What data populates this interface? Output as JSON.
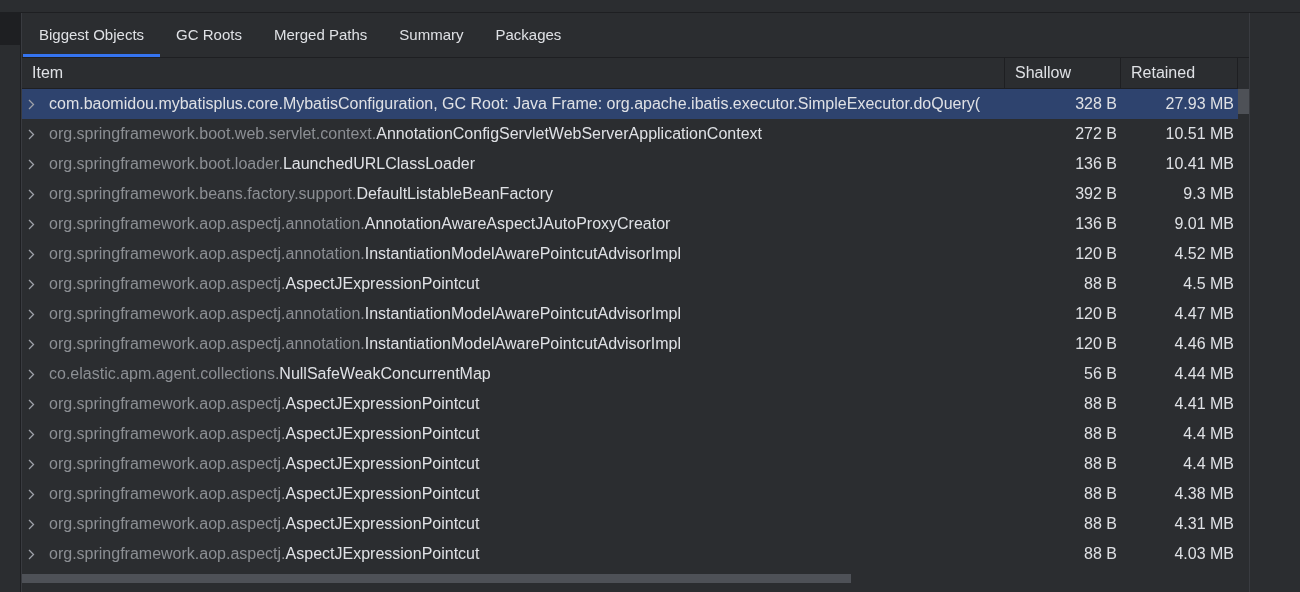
{
  "tabs": [
    {
      "label": "Biggest Objects",
      "selected": true
    },
    {
      "label": "GC Roots",
      "selected": false
    },
    {
      "label": "Merged Paths",
      "selected": false
    },
    {
      "label": "Summary",
      "selected": false
    },
    {
      "label": "Packages",
      "selected": false
    }
  ],
  "table": {
    "columns": [
      "Item",
      "Shallow",
      "Retained"
    ],
    "rows": [
      {
        "name": "com.baomidou.mybatisplus.core.MybatisConfiguration, GC Root: Java Frame: org.apache.ibatis.executor.SimpleExecutor.doQuery(",
        "shallow": "328 B",
        "retained": "27.93 MB",
        "selected": true
      },
      {
        "package": "org.springframework.boot.web.servlet.context.",
        "name": "AnnotationConfigServletWebServerApplicationContext",
        "shallow": "272 B",
        "retained": "10.51 MB",
        "selected": false
      },
      {
        "package": "org.springframework.boot.loader.",
        "name": "LaunchedURLClassLoader",
        "shallow": "136 B",
        "retained": "10.41 MB",
        "selected": false
      },
      {
        "package": "org.springframework.beans.factory.support.",
        "name": "DefaultListableBeanFactory",
        "shallow": "392 B",
        "retained": "9.3 MB",
        "selected": false
      },
      {
        "package": "org.springframework.aop.aspectj.annotation.",
        "name": "AnnotationAwareAspectJAutoProxyCreator",
        "shallow": "136 B",
        "retained": "9.01 MB",
        "selected": false
      },
      {
        "package": "org.springframework.aop.aspectj.annotation.",
        "name": "InstantiationModelAwarePointcutAdvisorImpl",
        "shallow": "120 B",
        "retained": "4.52 MB",
        "selected": false
      },
      {
        "package": "org.springframework.aop.aspectj.",
        "name": "AspectJExpressionPointcut",
        "shallow": "88 B",
        "retained": "4.5 MB",
        "selected": false
      },
      {
        "package": "org.springframework.aop.aspectj.annotation.",
        "name": "InstantiationModelAwarePointcutAdvisorImpl",
        "shallow": "120 B",
        "retained": "4.47 MB",
        "selected": false
      },
      {
        "package": "org.springframework.aop.aspectj.annotation.",
        "name": "InstantiationModelAwarePointcutAdvisorImpl",
        "shallow": "120 B",
        "retained": "4.46 MB",
        "selected": false
      },
      {
        "package": "co.elastic.apm.agent.collections.",
        "name": "NullSafeWeakConcurrentMap",
        "shallow": "56 B",
        "retained": "4.44 MB",
        "selected": false
      },
      {
        "package": "org.springframework.aop.aspectj.",
        "name": "AspectJExpressionPointcut",
        "shallow": "88 B",
        "retained": "4.41 MB",
        "selected": false
      },
      {
        "package": "org.springframework.aop.aspectj.",
        "name": "AspectJExpressionPointcut",
        "shallow": "88 B",
        "retained": "4.4 MB",
        "selected": false
      },
      {
        "package": "org.springframework.aop.aspectj.",
        "name": "AspectJExpressionPointcut",
        "shallow": "88 B",
        "retained": "4.4 MB",
        "selected": false
      },
      {
        "package": "org.springframework.aop.aspectj.",
        "name": "AspectJExpressionPointcut",
        "shallow": "88 B",
        "retained": "4.38 MB",
        "selected": false
      },
      {
        "package": "org.springframework.aop.aspectj.",
        "name": "AspectJExpressionPointcut",
        "shallow": "88 B",
        "retained": "4.31 MB",
        "selected": false
      },
      {
        "package": "org.springframework.aop.aspectj.",
        "name": "AspectJExpressionPointcut",
        "shallow": "88 B",
        "retained": "4.03 MB",
        "selected": false
      }
    ]
  }
}
